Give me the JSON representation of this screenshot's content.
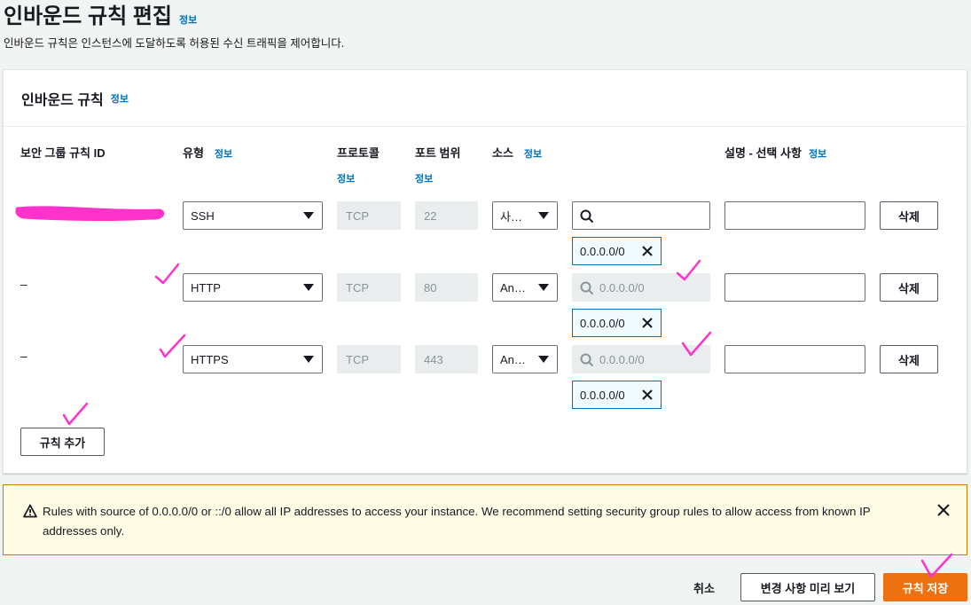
{
  "page": {
    "title": "인바운드 규칙 편집",
    "title_info": "정보",
    "description": "인바운드 규칙은 인스턴스에 도달하도록 허용된 수신 트래픽을 제어합니다."
  },
  "panel": {
    "title": "인바운드 규칙",
    "title_info": "정보",
    "columns": {
      "rule_id": "보안 그룹 규칙 ID",
      "type": "유형",
      "type_info": "정보",
      "protocol": "프로토콜",
      "protocol_info": "정보",
      "port_range": "포트 범위",
      "port_range_info": "정보",
      "source": "소스",
      "source_info": "정보",
      "description": "설명 - 선택 사항",
      "description_info": "정보"
    },
    "rows": [
      {
        "rule_id": "",
        "type": "SSH",
        "protocol": "TCP",
        "port": "22",
        "source": "사…",
        "search_placeholder": "",
        "cidr": "0.0.0.0/0",
        "delete": "삭제"
      },
      {
        "rule_id": "–",
        "type": "HTTP",
        "protocol": "TCP",
        "port": "80",
        "source": "An…",
        "search_placeholder": "0.0.0.0/0",
        "cidr": "0.0.0.0/0",
        "delete": "삭제"
      },
      {
        "rule_id": "–",
        "type": "HTTPS",
        "protocol": "TCP",
        "port": "443",
        "source": "An…",
        "search_placeholder": "0.0.0.0/0",
        "cidr": "0.0.0.0/0",
        "delete": "삭제"
      }
    ],
    "add_rule": "규칙 추가"
  },
  "warning": {
    "text": "Rules with source of 0.0.0.0/0 or ::/0 allow all IP addresses to access your instance. We recommend setting security group rules to allow access from known IP addresses only."
  },
  "footer": {
    "cancel": "취소",
    "preview": "변경 사항 미리 보기",
    "save": "규칙 저장"
  },
  "colors": {
    "accent": "#ec7211",
    "link": "#0073bb",
    "annotation": "#ff33cc",
    "warning_border": "#c57e00"
  }
}
